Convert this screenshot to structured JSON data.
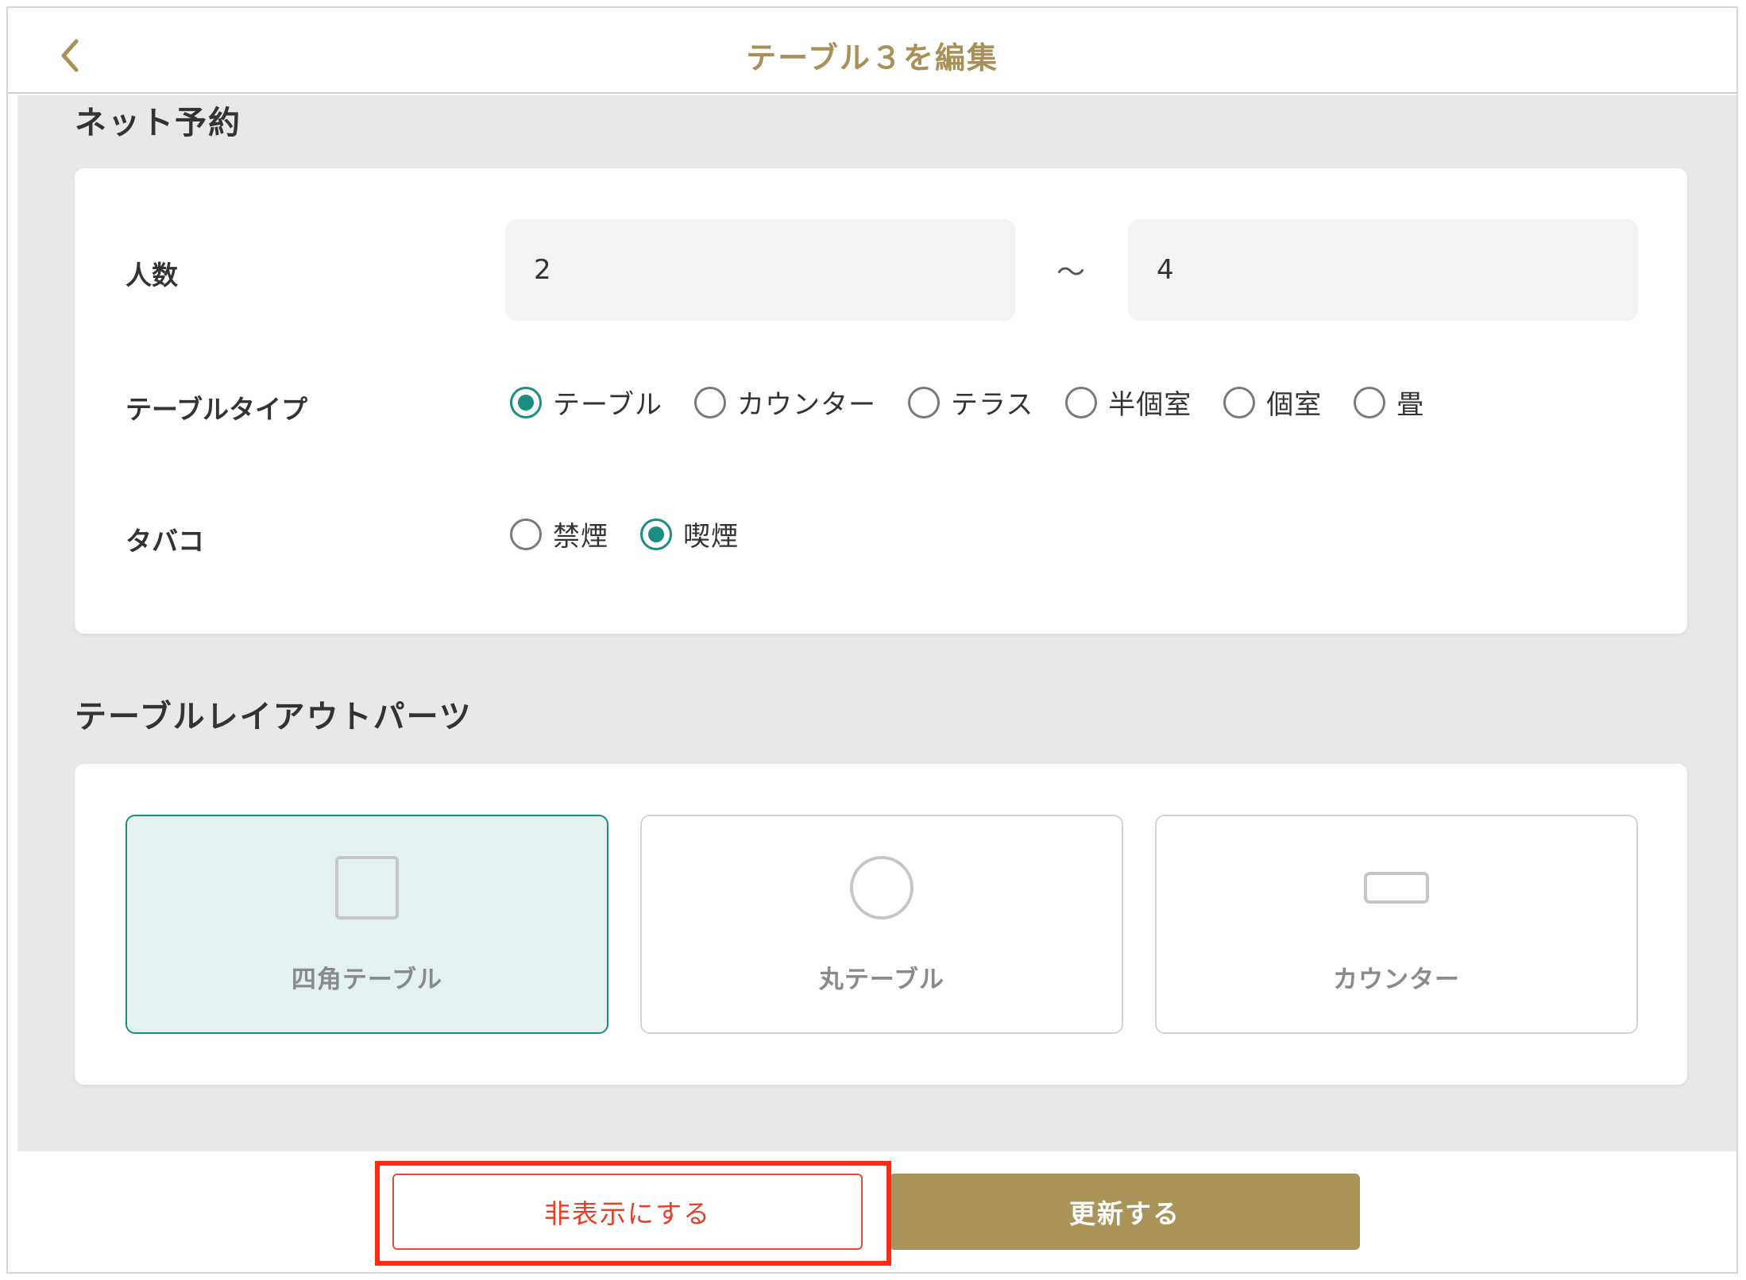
{
  "header": {
    "title": "テーブル３を編集",
    "back_icon": "chevron-left-icon",
    "accent_color": "#a89058"
  },
  "net_reservation": {
    "section_title": "ネット予約",
    "capacity": {
      "label": "人数",
      "min_value": "2",
      "separator": "〜",
      "max_value": "4"
    },
    "table_type": {
      "label": "テーブルタイプ",
      "options": [
        {
          "label": "テーブル",
          "checked": true
        },
        {
          "label": "カウンター",
          "checked": false
        },
        {
          "label": "テラス",
          "checked": false
        },
        {
          "label": "半個室",
          "checked": false
        },
        {
          "label": "個室",
          "checked": false
        },
        {
          "label": "畳",
          "checked": false
        }
      ]
    },
    "tobacco": {
      "label": "タバコ",
      "options": [
        {
          "label": "禁煙",
          "checked": false
        },
        {
          "label": "喫煙",
          "checked": true
        }
      ]
    },
    "radio_color": "#1a8e80"
  },
  "layout_parts": {
    "section_title": "テーブルレイアウトパーツ",
    "parts": [
      {
        "label": "四角テーブル",
        "icon": "square-table-icon",
        "selected": true
      },
      {
        "label": "丸テーブル",
        "icon": "round-table-icon",
        "selected": false
      },
      {
        "label": "カウンター",
        "icon": "counter-icon",
        "selected": false
      }
    ]
  },
  "footer": {
    "hide_label": "非表示にする",
    "update_label": "更新する",
    "hide_color": "#e5402a",
    "update_color": "#ab9459",
    "highlight_color": "#ff2a14"
  }
}
